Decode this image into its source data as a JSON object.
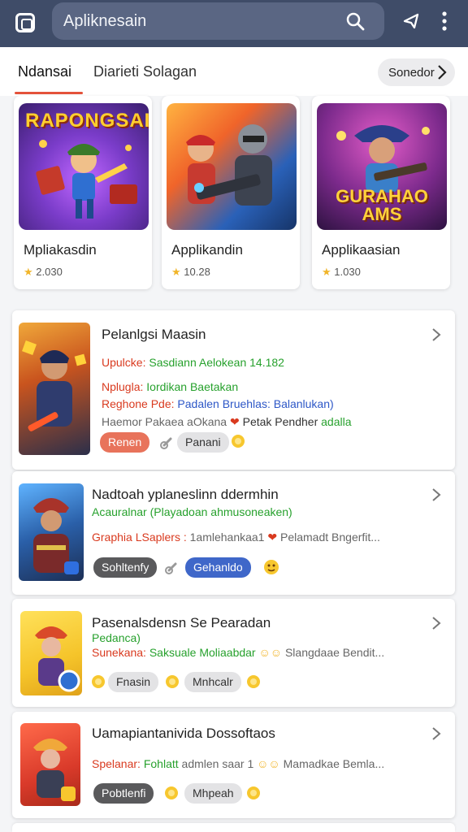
{
  "appbar": {
    "search_text": "Apliknesain",
    "icons": [
      "app-logo-icon",
      "search-icon",
      "share-icon",
      "more-vert-icon"
    ]
  },
  "tabs": {
    "active": "Ndansai",
    "inactive": "Diarieti Solagan",
    "chip_label": "Sonedor"
  },
  "featured": [
    {
      "name": "Mpliakasdin",
      "rating": "2.030",
      "art_title": "RAPONGSAI"
    },
    {
      "name": "Applikandin",
      "rating": "10.28",
      "art_title": ""
    },
    {
      "name": "Applikaasian",
      "rating": "1.030",
      "art_title": "GURAHAO AMS"
    }
  ],
  "list": [
    {
      "title": "Pelanlgsi Maasin",
      "line1_label": "Upulcke:",
      "line1_value": "Sasdiann Aelokean 14.182",
      "line2_label": "Nplugla:",
      "line2_value": "Iordikan Baetakan",
      "line3_label": "Reghone Pde:",
      "line3_value": "Padalen Bruehlas: Balanlukan)",
      "line4_text": "Haemor Pakaea aOkana",
      "line4_tail": "Petak Pendher",
      "line4_green": "adalla",
      "pills": [
        "Renen",
        "Panani"
      ]
    },
    {
      "title": "Nadtoah yplaneslinn ddermhin",
      "line1_label": "",
      "line1_value": "Acauralnar (Playadoan ahmusoneaken)",
      "line2_label": "Graphia LSaplers :",
      "line2_value": "1amlehankaa1",
      "line2_tail": "Pelamadt Bngerfit...",
      "pills": [
        "Sohltenfy",
        "Gehanldo"
      ]
    },
    {
      "title": "Pasenalsdensn Se Pearadan",
      "line1_label": "Pedanca)",
      "line1_value": "",
      "line2_label": "Sunekana:",
      "line2_value": "Saksuale Moliaabdar",
      "line2_tail": "Slangdaae Bendit...",
      "pills": [
        "Fnasin",
        "Mnhcalr"
      ]
    },
    {
      "title": "Uamapiantanivida Dossoftaos",
      "line1_label": "Spelanar:",
      "line1_value": "Fohlatt",
      "line1_tail": "admlen saar 1",
      "line1_tail2": "Mamadkae Bemla...",
      "pills": [
        "Pobtlenfi",
        "Mhpeah"
      ]
    }
  ],
  "colors": {
    "appbar": "#3f4c68",
    "accent": "#e4523b",
    "green": "#27a12d",
    "blue": "#2d57c7",
    "red": "#d93a1f"
  }
}
